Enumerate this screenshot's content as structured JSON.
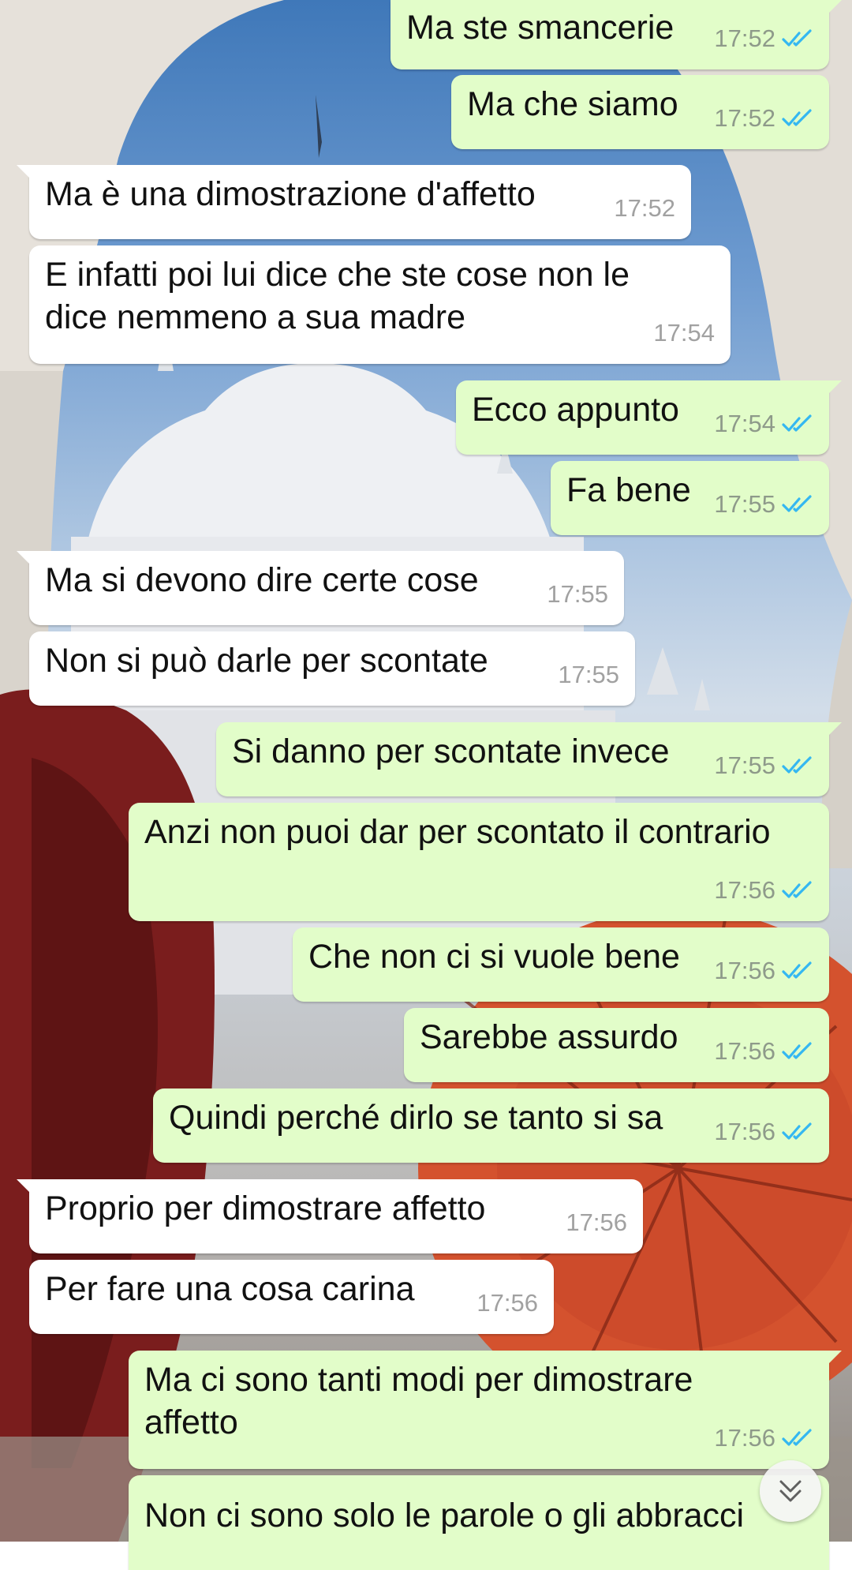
{
  "chat": {
    "colors": {
      "outgoing_bubble": "#e2fdc9",
      "incoming_bubble": "#ffffff",
      "read_ticks": "#34b7f1",
      "time_text": "#8e9a8a"
    },
    "messages": [
      {
        "direction": "out",
        "text": "Ma ste smancerie",
        "time": "17:52",
        "status": "read-ticks-icon"
      },
      {
        "direction": "out",
        "text": "Ma che siamo",
        "time": "17:52",
        "status": "read-ticks-icon"
      },
      {
        "direction": "in",
        "text": "Ma è una dimostrazione d'affetto",
        "time": "17:52"
      },
      {
        "direction": "in",
        "text": "E infatti poi lui dice che ste cose non le\ndice nemmeno a sua madre",
        "time": "17:54"
      },
      {
        "direction": "out",
        "text": "Ecco appunto",
        "time": "17:54",
        "status": "read-ticks-icon"
      },
      {
        "direction": "out",
        "text": "Fa bene",
        "time": "17:55",
        "status": "read-ticks-icon"
      },
      {
        "direction": "in",
        "text": "Ma si devono dire certe cose",
        "time": "17:55"
      },
      {
        "direction": "in",
        "text": "Non si può darle per scontate",
        "time": "17:55"
      },
      {
        "direction": "out",
        "text": "Si danno per scontate invece",
        "time": "17:55",
        "status": "read-ticks-icon"
      },
      {
        "direction": "out",
        "text": "Anzi non puoi dar per scontato il contrario",
        "time": "17:56",
        "status": "read-ticks-icon"
      },
      {
        "direction": "out",
        "text": "Che non ci si vuole bene",
        "time": "17:56",
        "status": "read-ticks-icon"
      },
      {
        "direction": "out",
        "text": "Sarebbe assurdo",
        "time": "17:56",
        "status": "read-ticks-icon"
      },
      {
        "direction": "out",
        "text": "Quindi perché dirlo se tanto si sa",
        "time": "17:56",
        "status": "read-ticks-icon"
      },
      {
        "direction": "in",
        "text": "Proprio per dimostrare affetto",
        "time": "17:56"
      },
      {
        "direction": "in",
        "text": "Per fare una cosa carina",
        "time": "17:56"
      },
      {
        "direction": "out",
        "text": "Ma ci sono tanti modi per dimostrare\naffetto",
        "time": "17:56",
        "status": "read-ticks-icon"
      },
      {
        "direction": "out",
        "text": "Non ci sono solo le parole o gli abbracci",
        "time": "",
        "status": ""
      }
    ]
  },
  "scroll_button": {
    "icon": "double-chevron-down-icon"
  }
}
